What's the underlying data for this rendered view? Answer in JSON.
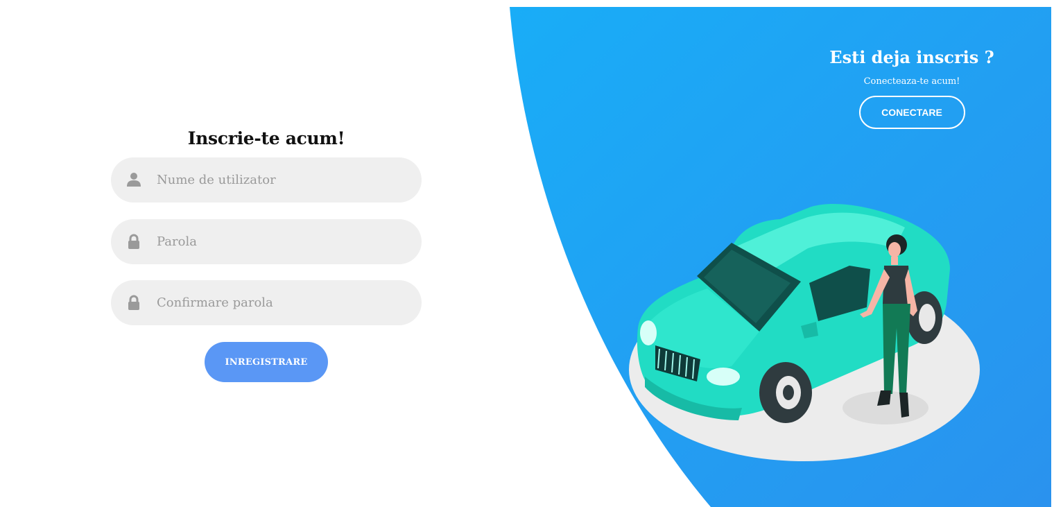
{
  "signup": {
    "title": "Inscrie-te acum!",
    "username_placeholder": "Nume de utilizator",
    "password_placeholder": "Parola",
    "confirm_placeholder": "Confirmare parola",
    "register_label": "INREGISTRARE"
  },
  "login_panel": {
    "title": "Esti deja inscris ?",
    "subtitle": "Conecteaza-te acum!",
    "connect_label": "CONECTARE"
  },
  "colors": {
    "panel_blue": "#1da8f5",
    "panel_blue_dark": "#2794ef",
    "register_button": "#5a97f5",
    "field_background": "#efefef",
    "car": "#1fe0c6"
  },
  "icons": {
    "username": "user-icon",
    "password": "lock-icon",
    "confirm": "lock-icon"
  }
}
